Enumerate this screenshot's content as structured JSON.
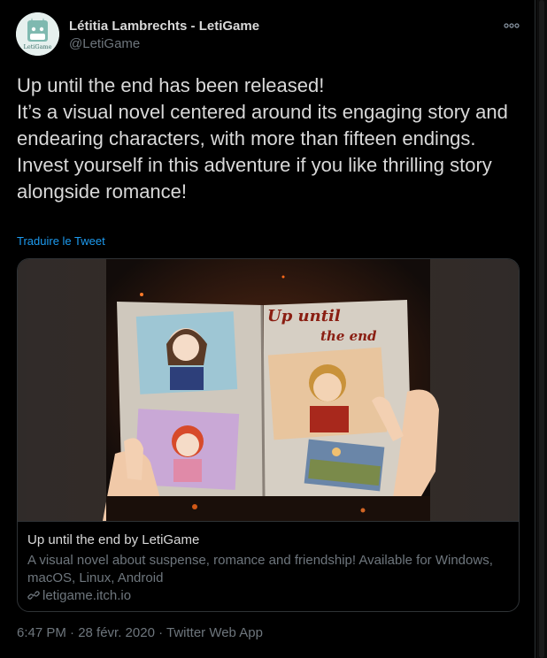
{
  "author": {
    "display_name": "Létitia Lambrechts - LetiGame",
    "handle": "@LetiGame",
    "avatar_text": "LetiGame"
  },
  "tweet": {
    "text": "Up until the end has been released!\nIt’s a visual novel centered around its engaging story and endearing characters, with more than fifteen endings.\nInvest yourself in this adventure if you like thrilling story alongside romance!",
    "translate_label": "Traduire le Tweet"
  },
  "card": {
    "image_title_line1": "Up until",
    "image_title_line2": "the end",
    "title": "Up until the end by LetiGame",
    "description": "A visual novel about suspense, romance and friendship! Available for Windows, macOS, Linux, Android",
    "link_icon": "link-icon",
    "domain": "letigame.itch.io"
  },
  "meta": {
    "timestamp": "6:47 PM · 28 févr. 2020 · Twitter Web App"
  },
  "colors": {
    "background": "#000000",
    "text": "#d9d9d9",
    "muted": "#6e767d",
    "link": "#1d9bf0",
    "border": "#2f3336"
  }
}
